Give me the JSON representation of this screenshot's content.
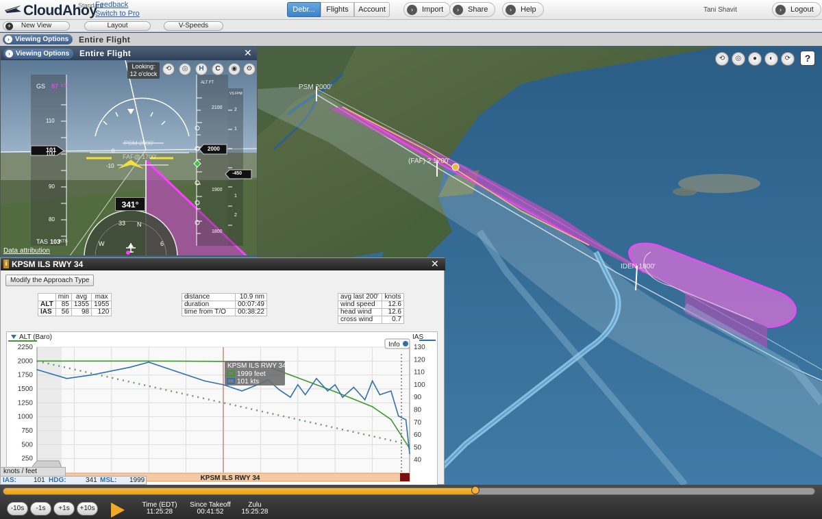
{
  "app": {
    "name": "CloudAhoy",
    "edition": "Standard",
    "feedback_link": "Feedback",
    "switch_link": "Switch to Pro",
    "user": "Tani Shavit"
  },
  "nav": {
    "tabs": [
      {
        "label": "Debr...",
        "active": true
      },
      {
        "label": "Flights",
        "active": false
      },
      {
        "label": "Account",
        "active": false
      }
    ],
    "import_label": "Import",
    "share_label": "Share",
    "help_label": "Help",
    "logout_label": "Logout"
  },
  "toolbar": {
    "new_view": "New View",
    "layout": "Layout",
    "vspeeds": "V-Speeds"
  },
  "view": {
    "viewing_options": "Viewing Options",
    "title": "Entire Flight"
  },
  "pfd": {
    "header_viewing_options": "Viewing Options",
    "header_title": "Entire Flight",
    "looking_line1": "Looking:",
    "looking_line2": "12 o'clock",
    "gs_label": "GS",
    "gs_value": "87",
    "gs_unit": "KTS",
    "tas_label": "TAS",
    "tas_value": "103",
    "tas_unit": "KTS",
    "speed_ticks": [
      "110",
      "100",
      "90",
      "80"
    ],
    "speed_current": "101",
    "alt_label": "ALT FT",
    "alt_ticks": [
      "2100",
      "1900",
      "1800"
    ],
    "alt_current": "2000",
    "vs_label": "VS FPM",
    "vs_ticks": [
      "2",
      "1",
      "1",
      "2"
    ],
    "vs_current": "-450",
    "pitch_labels": [
      "0",
      "-10"
    ],
    "heading": "341°",
    "compass": [
      "33",
      "N",
      "W",
      "6"
    ],
    "waypoint1": "PSM 2000'",
    "waypoint2": "FAF@ 1700'",
    "data_attribution": "Data attribution",
    "icon_labels": [
      "H",
      "C"
    ]
  },
  "map": {
    "waypoint_psm": "PSM 2000'",
    "waypoint_faf": "(FAF) 2 1700'",
    "waypoint_iden": "IDEN 1800'"
  },
  "approach": {
    "title": "KPSM ILS RWY 34",
    "modify_button": "Modify the Approach Type",
    "stats": {
      "headers": [
        "",
        "min",
        "avg",
        "max"
      ],
      "rows": [
        [
          "ALT",
          "85",
          "1355",
          "1955"
        ],
        [
          "IAS",
          "56",
          "98",
          "120"
        ]
      ]
    },
    "info": {
      "rows": [
        [
          "distance",
          "10.9 nm"
        ],
        [
          "duration",
          "00:07:49"
        ],
        [
          "time from T/O",
          "00:38:22"
        ]
      ]
    },
    "wind": {
      "headers": [
        "avg last 200'",
        "knots"
      ],
      "rows": [
        [
          "wind speed",
          "12.6"
        ],
        [
          "head wind",
          "12.6"
        ],
        [
          "cross wind",
          "0.7"
        ]
      ]
    },
    "tooltip": {
      "title": "KPSM ILS RWY 34",
      "alt": "1999 feet",
      "ias": "101 kts"
    },
    "info_button": "Info",
    "bar_label": "KPSM ILS RWY 34",
    "units_label": "knots / feet"
  },
  "readout": {
    "ias_label": "IAS:",
    "ias_value": "101",
    "hdg_label": "HDG:",
    "hdg_value": "341",
    "msl_label": "MSL:",
    "msl_value": "1999"
  },
  "timeline": {
    "progress": 0.58,
    "buttons": [
      "-10s",
      "-1s",
      "+1s",
      "+10s"
    ],
    "time_edt_label": "Time (EDT)",
    "time_edt": "11:25:28",
    "since_takeoff_label": "Since Takeoff",
    "since_takeoff": "00:41:52",
    "zulu_label": "Zulu",
    "zulu": "15:25:28"
  },
  "colors": {
    "alt_series": "#3a9a2a",
    "ias_series": "#2f6fb0",
    "flight_path": "#e040e0",
    "accent_orange": "#f3a826"
  },
  "chart_data": {
    "type": "line",
    "title": "",
    "xlabel": "",
    "ylabel": "ALT (Baro)",
    "y2label": "IAS",
    "ylim": [
      0,
      2250
    ],
    "y2lim": [
      30,
      130
    ],
    "y_ticks": [
      250,
      500,
      750,
      1000,
      1250,
      1500,
      1750,
      2000,
      2250
    ],
    "y2_ticks": [
      40,
      50,
      60,
      70,
      80,
      90,
      100,
      110,
      120,
      130
    ],
    "xlim": [
      0,
      100
    ],
    "series": [
      {
        "name": "ALT (Baro)",
        "axis": "left",
        "x": [
          0,
          8,
          15,
          30,
          45,
          55,
          60,
          62,
          70,
          80,
          90,
          95,
          100
        ],
        "values": [
          2000,
          2000,
          2000,
          2000,
          1995,
          1990,
          1980,
          1900,
          1700,
          1450,
          1180,
          950,
          430
        ]
      },
      {
        "name": "IAS",
        "axis": "right",
        "x": [
          0,
          8,
          15,
          25,
          30,
          35,
          40,
          45,
          50,
          55,
          60,
          62,
          65,
          68,
          70,
          72,
          75,
          78,
          80,
          82,
          85,
          88,
          90,
          92,
          95,
          97,
          99,
          100
        ],
        "values": [
          112,
          105,
          108,
          114,
          118,
          113,
          108,
          103,
          100,
          95,
          101,
          104,
          96,
          90,
          100,
          92,
          105,
          95,
          100,
          90,
          98,
          88,
          103,
          92,
          95,
          75,
          72,
          45
        ]
      },
      {
        "name": "glidepath",
        "axis": "left",
        "style": "dotted",
        "x": [
          0,
          100
        ],
        "values": [
          2000,
          500
        ]
      }
    ]
  }
}
